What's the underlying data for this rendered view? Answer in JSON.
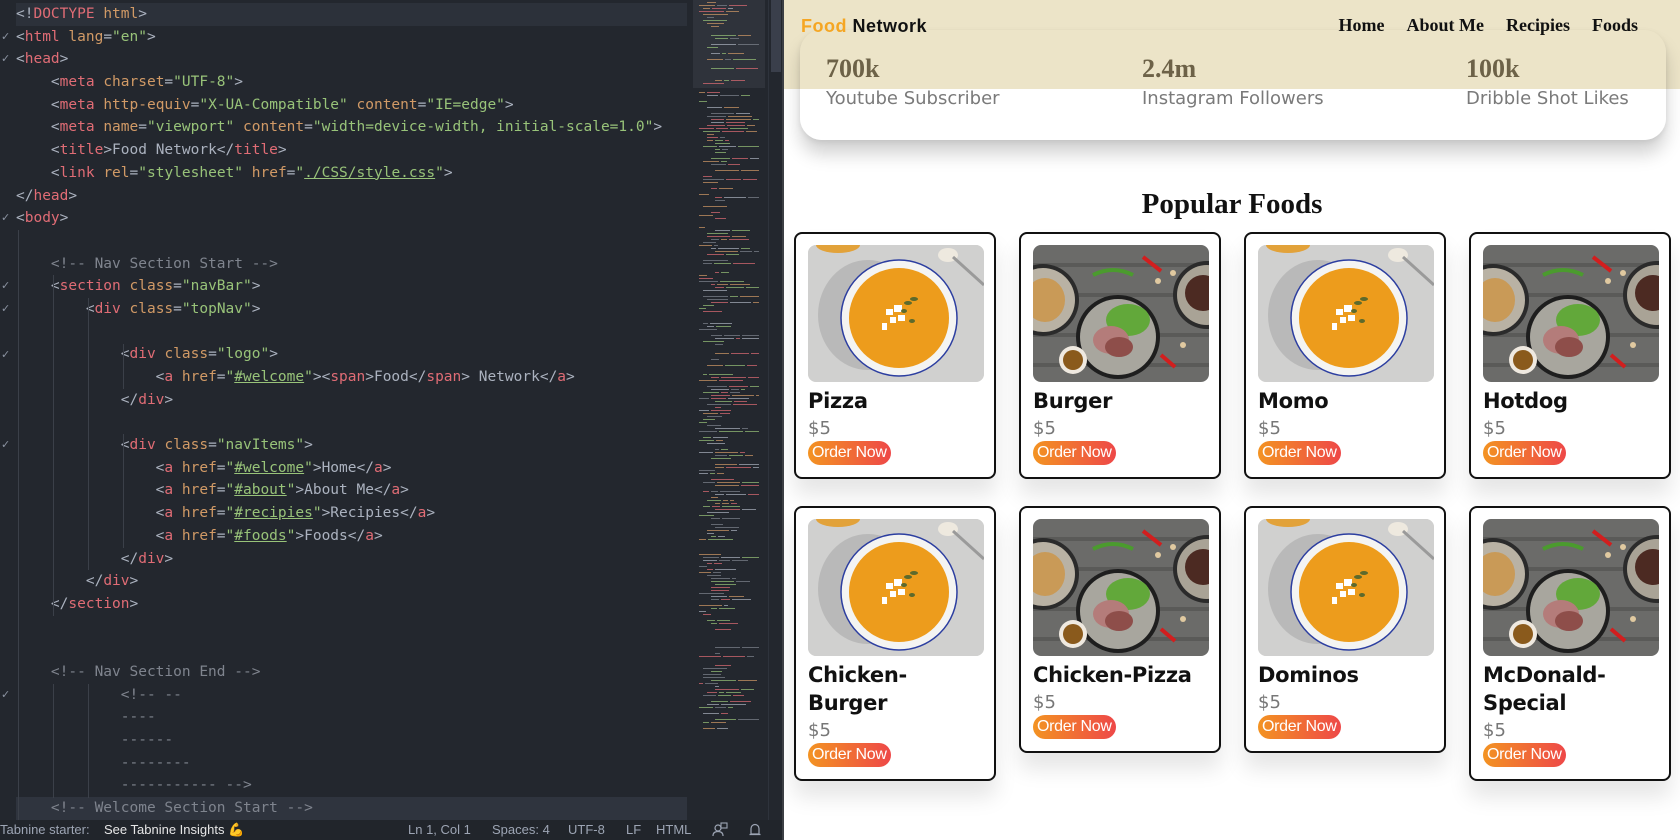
{
  "editor": {
    "language": "HTML",
    "lines": [
      [
        [
          "punct",
          "<!"
        ],
        [
          "tag",
          "DOCTYPE"
        ],
        [
          "punct",
          " "
        ],
        [
          "attr",
          "html"
        ],
        [
          "punct",
          ">"
        ]
      ],
      [
        [
          "punct",
          "<"
        ],
        [
          "tag",
          "html"
        ],
        [
          "punct",
          " "
        ],
        [
          "attr",
          "lang"
        ],
        [
          "punct",
          "="
        ],
        [
          "str",
          "\"en\""
        ],
        [
          "punct",
          ">"
        ]
      ],
      [
        [
          "punct",
          "<"
        ],
        [
          "tag",
          "head"
        ],
        [
          "punct",
          ">"
        ]
      ],
      [
        [
          "punct",
          "    <"
        ],
        [
          "tag",
          "meta"
        ],
        [
          "punct",
          " "
        ],
        [
          "attr",
          "charset"
        ],
        [
          "punct",
          "="
        ],
        [
          "str",
          "\"UTF-8\""
        ],
        [
          "punct",
          ">"
        ]
      ],
      [
        [
          "punct",
          "    <"
        ],
        [
          "tag",
          "meta"
        ],
        [
          "punct",
          " "
        ],
        [
          "attr",
          "http-equiv"
        ],
        [
          "punct",
          "="
        ],
        [
          "str",
          "\"X-UA-Compatible\""
        ],
        [
          "punct",
          " "
        ],
        [
          "attr",
          "content"
        ],
        [
          "punct",
          "="
        ],
        [
          "str",
          "\"IE=edge\""
        ],
        [
          "punct",
          ">"
        ]
      ],
      [
        [
          "punct",
          "    <"
        ],
        [
          "tag",
          "meta"
        ],
        [
          "punct",
          " "
        ],
        [
          "attr",
          "name"
        ],
        [
          "punct",
          "="
        ],
        [
          "str",
          "\"viewport\""
        ],
        [
          "punct",
          " "
        ],
        [
          "attr",
          "content"
        ],
        [
          "punct",
          "="
        ],
        [
          "str",
          "\"width=device-width, initial-scale=1.0\""
        ],
        [
          "punct",
          ">"
        ]
      ],
      [
        [
          "punct",
          "    <"
        ],
        [
          "tag",
          "title"
        ],
        [
          "punct",
          ">Food Network</"
        ],
        [
          "tag",
          "title"
        ],
        [
          "punct",
          ">"
        ]
      ],
      [
        [
          "punct",
          "    <"
        ],
        [
          "tag",
          "link"
        ],
        [
          "punct",
          " "
        ],
        [
          "attr",
          "rel"
        ],
        [
          "punct",
          "="
        ],
        [
          "str",
          "\"stylesheet\""
        ],
        [
          "punct",
          " "
        ],
        [
          "attr",
          "href"
        ],
        [
          "punct",
          "="
        ],
        [
          "str",
          "\""
        ],
        [
          "str u",
          "./CSS/style.css"
        ],
        [
          "str",
          "\""
        ],
        [
          "punct",
          ">"
        ]
      ],
      [
        [
          "punct",
          "</"
        ],
        [
          "tag",
          "head"
        ],
        [
          "punct",
          ">"
        ]
      ],
      [
        [
          "punct",
          "<"
        ],
        [
          "tag",
          "body"
        ],
        [
          "punct",
          ">"
        ]
      ],
      [],
      [
        [
          "cmt",
          "    <!-- Nav Section Start -->"
        ]
      ],
      [
        [
          "punct",
          "    <"
        ],
        [
          "tag",
          "section"
        ],
        [
          "punct",
          " "
        ],
        [
          "attr",
          "class"
        ],
        [
          "punct",
          "="
        ],
        [
          "str",
          "\"navBar\""
        ],
        [
          "punct",
          ">"
        ]
      ],
      [
        [
          "punct",
          "        <"
        ],
        [
          "tag",
          "div"
        ],
        [
          "punct",
          " "
        ],
        [
          "attr",
          "class"
        ],
        [
          "punct",
          "="
        ],
        [
          "str",
          "\"topNav\""
        ],
        [
          "punct",
          ">"
        ]
      ],
      [],
      [
        [
          "punct",
          "            <"
        ],
        [
          "tag",
          "div"
        ],
        [
          "punct",
          " "
        ],
        [
          "attr",
          "class"
        ],
        [
          "punct",
          "="
        ],
        [
          "str",
          "\"logo\""
        ],
        [
          "punct",
          ">"
        ]
      ],
      [
        [
          "punct",
          "                <"
        ],
        [
          "tag",
          "a"
        ],
        [
          "punct",
          " "
        ],
        [
          "attr",
          "href"
        ],
        [
          "punct",
          "="
        ],
        [
          "str",
          "\""
        ],
        [
          "str u",
          "#welcome"
        ],
        [
          "str",
          "\""
        ],
        [
          "punct",
          "><"
        ],
        [
          "tag",
          "span"
        ],
        [
          "punct",
          ">Food</"
        ],
        [
          "tag",
          "span"
        ],
        [
          "punct",
          "> Network</"
        ],
        [
          "tag",
          "a"
        ],
        [
          "punct",
          ">"
        ]
      ],
      [
        [
          "punct",
          "            </"
        ],
        [
          "tag",
          "div"
        ],
        [
          "punct",
          ">"
        ]
      ],
      [],
      [
        [
          "punct",
          "            <"
        ],
        [
          "tag",
          "div"
        ],
        [
          "punct",
          " "
        ],
        [
          "attr",
          "class"
        ],
        [
          "punct",
          "="
        ],
        [
          "str",
          "\"navItems\""
        ],
        [
          "punct",
          ">"
        ]
      ],
      [
        [
          "punct",
          "                <"
        ],
        [
          "tag",
          "a"
        ],
        [
          "punct",
          " "
        ],
        [
          "attr",
          "href"
        ],
        [
          "punct",
          "="
        ],
        [
          "str",
          "\""
        ],
        [
          "str u",
          "#welcome"
        ],
        [
          "str",
          "\""
        ],
        [
          "punct",
          ">Home</"
        ],
        [
          "tag",
          "a"
        ],
        [
          "punct",
          ">"
        ]
      ],
      [
        [
          "punct",
          "                <"
        ],
        [
          "tag",
          "a"
        ],
        [
          "punct",
          " "
        ],
        [
          "attr",
          "href"
        ],
        [
          "punct",
          "="
        ],
        [
          "str",
          "\""
        ],
        [
          "str u",
          "#about"
        ],
        [
          "str",
          "\""
        ],
        [
          "punct",
          ">About Me</"
        ],
        [
          "tag",
          "a"
        ],
        [
          "punct",
          ">"
        ]
      ],
      [
        [
          "punct",
          "                <"
        ],
        [
          "tag",
          "a"
        ],
        [
          "punct",
          " "
        ],
        [
          "attr",
          "href"
        ],
        [
          "punct",
          "="
        ],
        [
          "str",
          "\""
        ],
        [
          "str u",
          "#recipies"
        ],
        [
          "str",
          "\""
        ],
        [
          "punct",
          ">Recipies</"
        ],
        [
          "tag",
          "a"
        ],
        [
          "punct",
          ">"
        ]
      ],
      [
        [
          "punct",
          "                <"
        ],
        [
          "tag",
          "a"
        ],
        [
          "punct",
          " "
        ],
        [
          "attr",
          "href"
        ],
        [
          "punct",
          "="
        ],
        [
          "str",
          "\""
        ],
        [
          "str u",
          "#foods"
        ],
        [
          "str",
          "\""
        ],
        [
          "punct",
          ">Foods</"
        ],
        [
          "tag",
          "a"
        ],
        [
          "punct",
          ">"
        ]
      ],
      [
        [
          "punct",
          "            </"
        ],
        [
          "tag",
          "div"
        ],
        [
          "punct",
          ">"
        ]
      ],
      [
        [
          "punct",
          "        </"
        ],
        [
          "tag",
          "div"
        ],
        [
          "punct",
          ">"
        ]
      ],
      [
        [
          "punct",
          "    </"
        ],
        [
          "tag",
          "section"
        ],
        [
          "punct",
          ">"
        ]
      ],
      [],
      [],
      [
        [
          "cmt",
          "    <!-- Nav Section End -->"
        ]
      ],
      [
        [
          "cmt",
          "            <!-- --"
        ]
      ],
      [
        [
          "cmt",
          "            ----"
        ]
      ],
      [
        [
          "cmt",
          "            ------"
        ]
      ],
      [
        [
          "cmt",
          "            --------"
        ]
      ],
      [
        [
          "cmt",
          "            ----------- -->"
        ]
      ],
      [
        [
          "cmt",
          "    <!-- Welcome Section Start -->"
        ]
      ]
    ],
    "fold_markers": [
      1,
      2,
      9,
      12,
      13,
      15,
      19,
      30
    ]
  },
  "statusbar": {
    "tabnine_label": "Tabnine starter:",
    "insights_label": "See Tabnine Insights",
    "insights_emoji": "💪",
    "cursor_position": "Ln 1, Col 1",
    "indentation": "Spaces: 4",
    "encoding": "UTF-8",
    "line_ending": "LF",
    "language_mode": "HTML"
  },
  "site": {
    "logo_highlight": "Food",
    "logo_rest": "Network",
    "nav": [
      "Home",
      "About Me",
      "Recipies",
      "Foods"
    ],
    "stats": [
      {
        "value": "700k",
        "label": "Youtube Subscriber"
      },
      {
        "value": "2.4m",
        "label": "Instagram Followers"
      },
      {
        "value": "100k",
        "label": "Dribble Shot Likes"
      }
    ],
    "section_title": "Popular Foods",
    "order_label": "Order Now",
    "foods": [
      {
        "name": "Pizza",
        "price": "$5",
        "image": "soup"
      },
      {
        "name": "Burger",
        "price": "$5",
        "image": "platter"
      },
      {
        "name": "Momo",
        "price": "$5",
        "image": "soup"
      },
      {
        "name": "Hotdog",
        "price": "$5",
        "image": "platter"
      },
      {
        "name": "Chicken-Burger",
        "price": "$5",
        "image": "soup"
      },
      {
        "name": "Chicken-Pizza",
        "price": "$5",
        "image": "platter"
      },
      {
        "name": "Dominos",
        "price": "$5",
        "image": "soup"
      },
      {
        "name": "McDonald-Special",
        "price": "$5",
        "image": "platter"
      }
    ]
  },
  "colors": {
    "editor_bg": "#23272e",
    "nav_band": "#ece4c8",
    "logo_accent": "#f5a623",
    "button_gradient_start": "#f39322",
    "button_gradient_end": "#ee4848"
  }
}
